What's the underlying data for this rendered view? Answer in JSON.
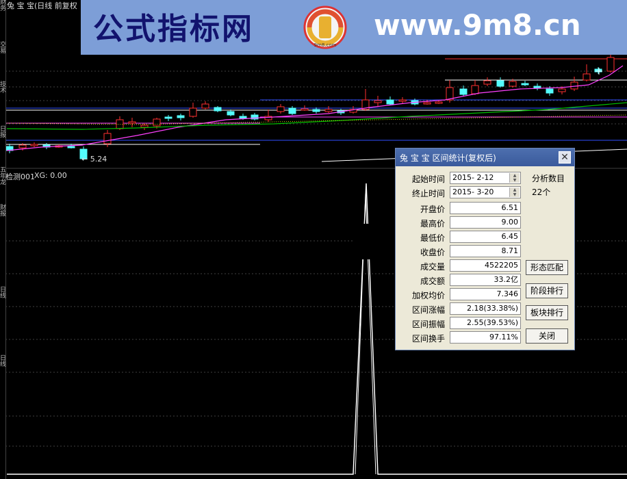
{
  "chart": {
    "title": "兔 宝 宝(日线 前复权",
    "low_price_label": "← 5.24",
    "indicator_name": "检测001",
    "indicator_value": "XG: 0.00"
  },
  "left_tabs": [
    "财 务",
    "交 易",
    "技 术",
    "日 报",
    "五 年 龙",
    "财 报",
    "日 线",
    "日 线"
  ],
  "banner": {
    "title": "公式指标网",
    "logo_text": "9m8.com",
    "url": "www.9m8.cn"
  },
  "dialog": {
    "title": "兔 宝 宝  区间统计(复权后)",
    "close_symbol": "✕",
    "start_label": "起始时间",
    "start_value": "2015- 2-12",
    "end_label": "终止时间",
    "end_value": "2015- 3-20",
    "analysis_label": "分析数目",
    "analysis_value": "22个",
    "rows": [
      {
        "label": "开盘价",
        "value": "6.51"
      },
      {
        "label": "最高价",
        "value": "9.00"
      },
      {
        "label": "最低价",
        "value": "6.45"
      },
      {
        "label": "收盘价",
        "value": "8.71"
      },
      {
        "label": "成交量",
        "value": "4522205"
      },
      {
        "label": "成交额",
        "value": "33.2亿"
      },
      {
        "label": "加权均价",
        "value": "7.346"
      },
      {
        "label": "区间涨幅",
        "value": "2.18(33.38%)"
      },
      {
        "label": "区间振幅",
        "value": "2.55(39.53%)"
      },
      {
        "label": "区间换手",
        "value": "97.11%"
      }
    ],
    "buttons": {
      "pattern_match": "形态匹配",
      "stage_rank": "阶段排行",
      "sector_rank": "板块排行",
      "close": "关闭"
    }
  },
  "colors": {
    "up": "#ff3030",
    "down": "#54fcfc",
    "ma_pink": "#ff40ff",
    "ma_green": "#00c000",
    "ma_white": "#ffffff",
    "ma_yellow": "#ffff00"
  }
}
